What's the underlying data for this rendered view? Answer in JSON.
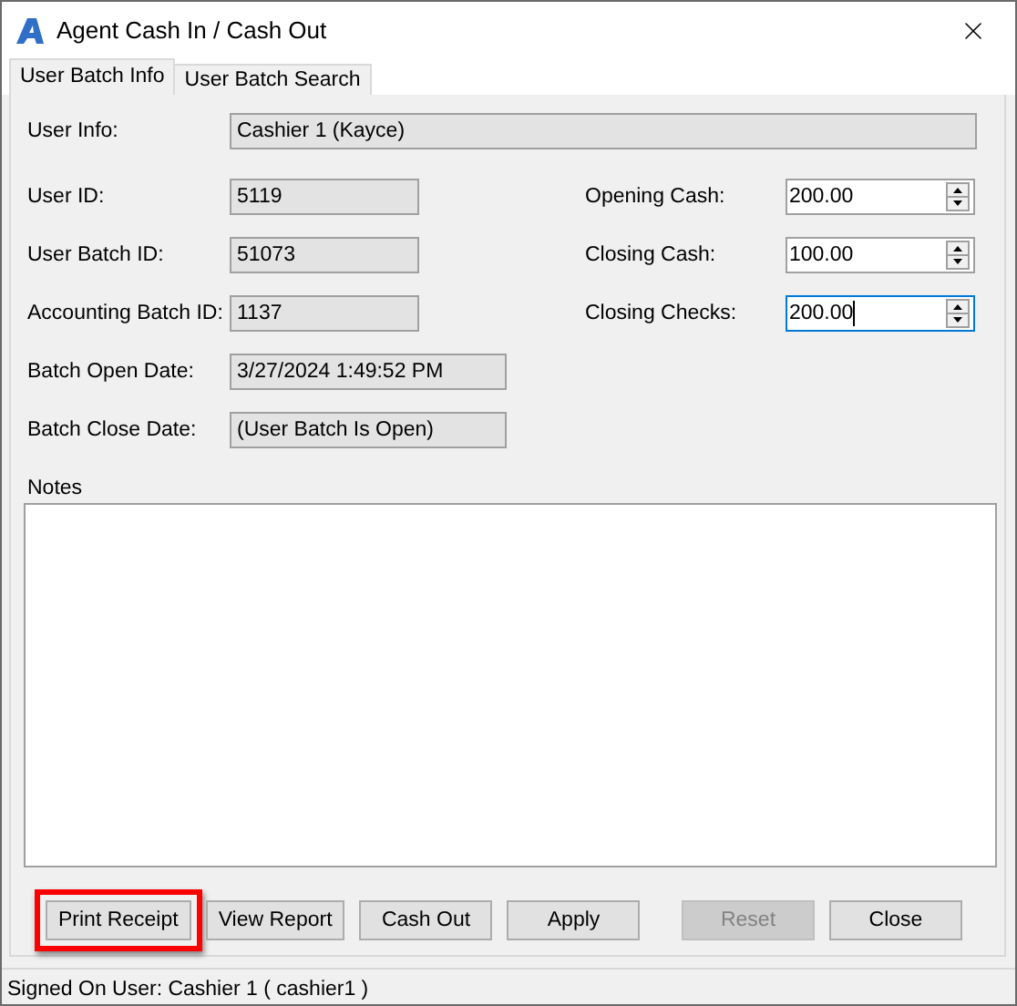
{
  "window": {
    "title": "Agent Cash In / Cash Out"
  },
  "tabs": [
    {
      "label": "User Batch Info",
      "selected": true
    },
    {
      "label": "User Batch Search",
      "selected": false
    }
  ],
  "user_info": {
    "label": "User Info:",
    "value": "Cashier 1 (Kayce)"
  },
  "left_fields": [
    {
      "label": "User ID:",
      "value": "5119"
    },
    {
      "label": "User Batch ID:",
      "value": "51073"
    },
    {
      "label": "Accounting Batch ID:",
      "value": "1137"
    },
    {
      "label": "Batch Open Date:",
      "value": "3/27/2024 1:49:52 PM"
    },
    {
      "label": "Batch Close Date:",
      "value": "(User Batch Is Open)"
    }
  ],
  "amounts": [
    {
      "label": "Opening Cash:",
      "value": "200.00",
      "focused": false
    },
    {
      "label": "Closing Cash:",
      "value": "100.00",
      "focused": false
    },
    {
      "label": "Closing Checks:",
      "value": "200.00",
      "focused": true
    }
  ],
  "notes": {
    "label": "Notes"
  },
  "buttons": [
    {
      "label": "Print Receipt",
      "disabled": false,
      "highlighted": true
    },
    {
      "label": "View Report",
      "disabled": false,
      "highlighted": false
    },
    {
      "label": "Cash Out",
      "disabled": false,
      "highlighted": false
    },
    {
      "label": "Apply",
      "disabled": false,
      "highlighted": false
    },
    {
      "label": "Reset",
      "disabled": true,
      "highlighted": false
    },
    {
      "label": "Close",
      "disabled": false,
      "highlighted": false
    }
  ],
  "status_bar": "Signed On User: Cashier 1 ( cashier1 )"
}
